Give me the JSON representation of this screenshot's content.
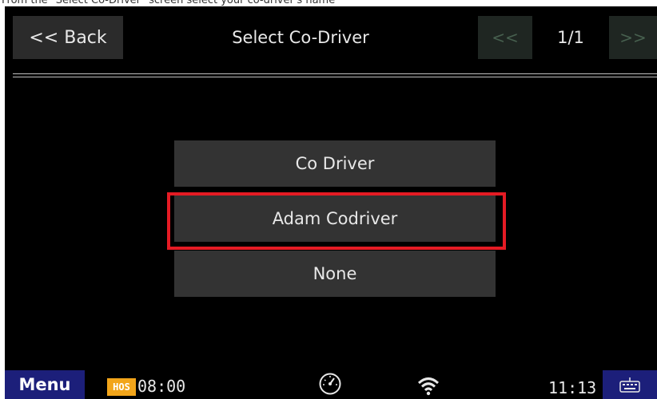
{
  "caption": "From the \"Select Co-Driver\" screen select your co-driver's name",
  "header": {
    "back_label": "<< Back",
    "title": "Select Co-Driver",
    "prev_label": "<<",
    "page_indicator": "1/1",
    "next_label": ">>"
  },
  "drivers": [
    {
      "label": "Co Driver"
    },
    {
      "label": "Adam Codriver",
      "highlighted": true
    },
    {
      "label": "None"
    }
  ],
  "status_bar": {
    "menu_label": "Menu",
    "hos_badge": "HOS",
    "hos_time": "08:00",
    "clock": "11:13",
    "icons": [
      "gauge-icon",
      "wifi-icon",
      "keyboard-icon"
    ]
  },
  "colors": {
    "highlight": "#e51b24",
    "menu_bg": "#1c1f7a",
    "hos_badge": "#f2a51a"
  }
}
